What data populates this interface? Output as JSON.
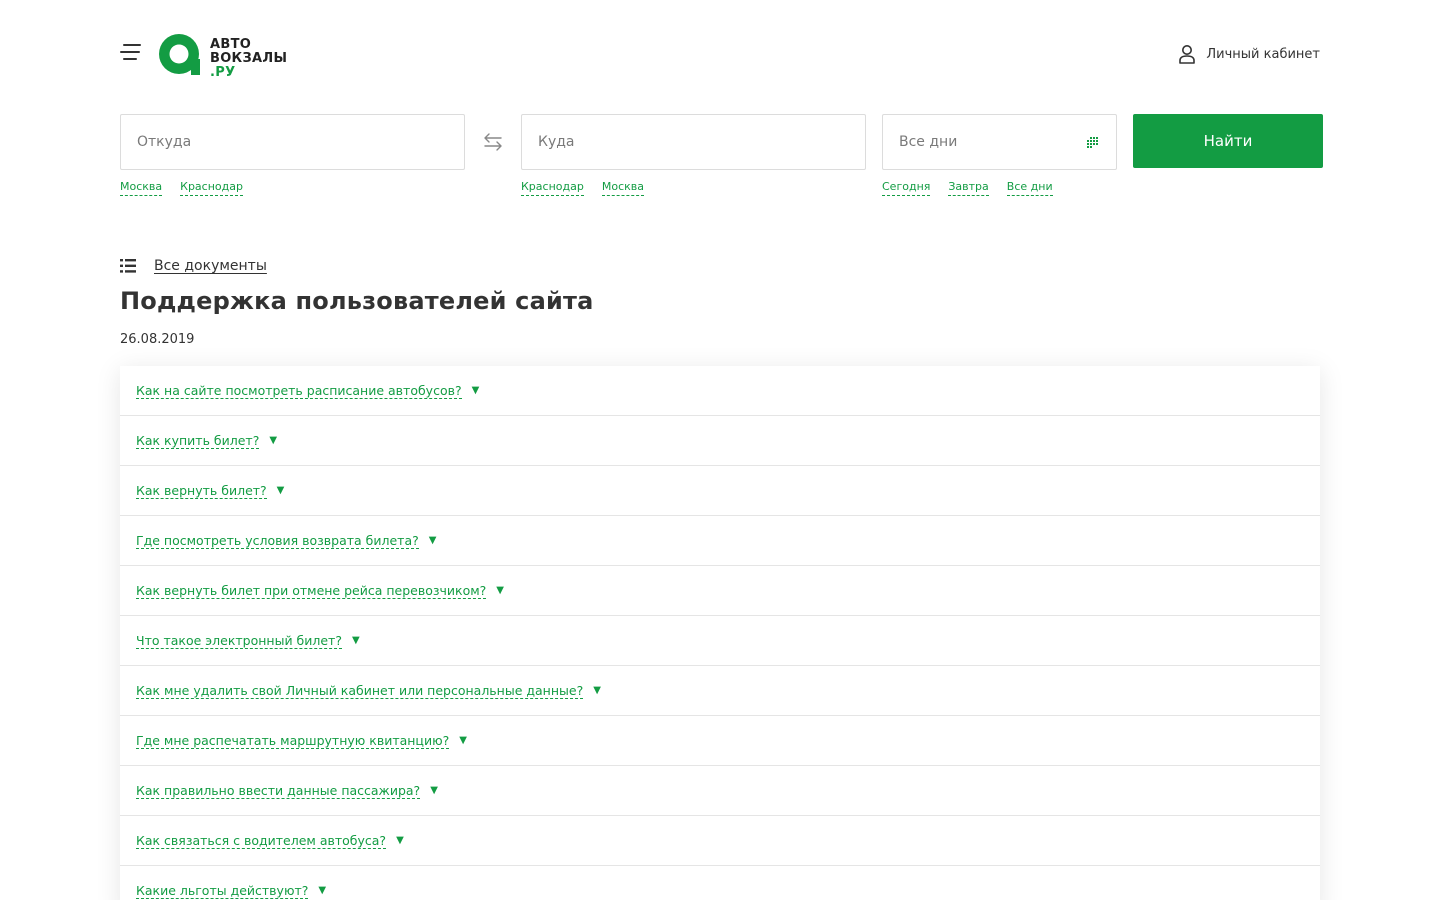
{
  "header": {
    "logo": {
      "line1": "АВТО",
      "line2": "ВОКЗАЛЫ",
      "line3": ".РУ"
    },
    "cabinet_label": "Личный кабинет"
  },
  "search": {
    "from_placeholder": "Откуда",
    "to_placeholder": "Куда",
    "date_placeholder": "Все дни",
    "button_label": "Найти",
    "from_quick": [
      "Москва",
      "Краснодар"
    ],
    "to_quick": [
      "Краснодар",
      "Москва"
    ],
    "date_quick": [
      "Сегодня",
      "Завтра",
      "Все дни"
    ]
  },
  "docs": {
    "all_docs_label": "Все документы",
    "title": "Поддержка пользователей сайта",
    "date": "26.08.2019"
  },
  "faq": {
    "arrow": "▼",
    "items": [
      "Как на сайте посмотреть расписание автобусов?",
      "Как купить билет?",
      "Как вернуть билет?",
      "Где посмотреть условия возврата билета?",
      "Как вернуть билет при отмене рейса перевозчиком?",
      "Что такое электронный билет?",
      "Как мне удалить свой Личный кабинет или персональные данные?",
      "Где мне распечатать маршрутную квитанцию?",
      "Как правильно ввести данные пассажира?",
      "Как связаться с водителем автобуса?",
      "Какие льготы действуют?"
    ]
  },
  "colors": {
    "accent": "#139c43",
    "text": "#333333",
    "border": "#dcdcdc"
  },
  "icons": {
    "menu": "hamburger-icon",
    "user": "user-icon",
    "swap": "swap-arrows-icon",
    "calendar": "calendar-grid-icon",
    "list": "list-icon"
  }
}
